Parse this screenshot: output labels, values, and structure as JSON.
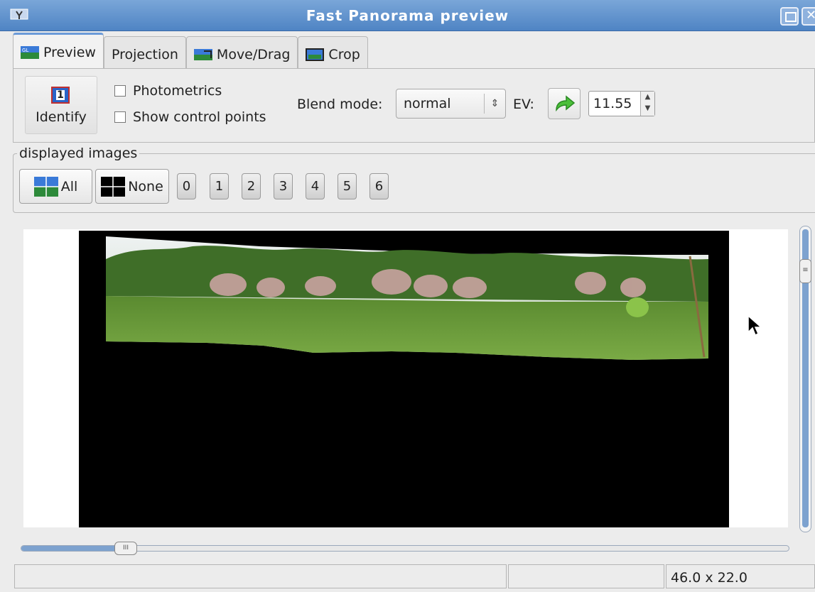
{
  "window": {
    "title": "Fast Panorama preview"
  },
  "tabs": [
    {
      "label": "Preview",
      "active": true,
      "icon": "gl-preview-icon"
    },
    {
      "label": "Projection",
      "active": false
    },
    {
      "label": "Move/Drag",
      "active": false,
      "icon": "move-drag-icon"
    },
    {
      "label": "Crop",
      "active": false,
      "icon": "crop-icon"
    }
  ],
  "toolbar": {
    "identify_label": "Identify",
    "identify_icon_number": "1",
    "photometrics_label": "Photometrics",
    "photometrics_checked": false,
    "control_points_label": "Show control points",
    "control_points_checked": false,
    "blend_label": "Blend mode:",
    "blend_value": "normal",
    "ev_label": "EV:",
    "ev_value": "11.55"
  },
  "displayed_images": {
    "label": "displayed images",
    "all_label": "All",
    "none_label": "None",
    "numbers": [
      "0",
      "1",
      "2",
      "3",
      "4",
      "5",
      "6"
    ]
  },
  "colors": {
    "titlebar": "#5a8cc8",
    "accent": "#6a9ad8",
    "canvas_bg": "#000000",
    "sky": "#e8edf0",
    "grass": "#6c9a3a",
    "trees": "#3d6a25"
  },
  "scroll": {
    "horizontal_position": 0.14,
    "vertical_position": 0.1
  },
  "status": {
    "field1": "",
    "field2": "",
    "field3": "46.0 x 22.0"
  }
}
